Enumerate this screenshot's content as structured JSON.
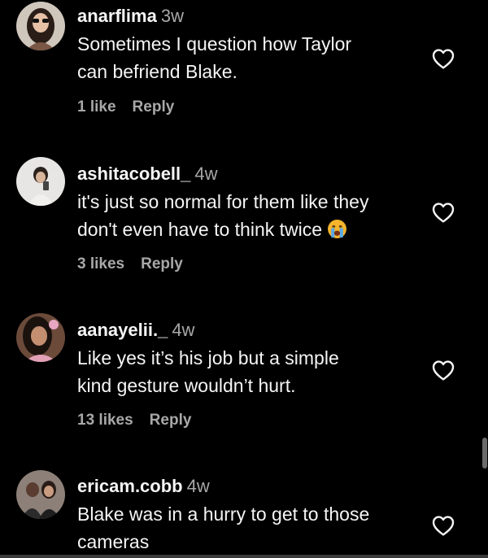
{
  "comments": [
    {
      "username": "anarflima",
      "time": "3w",
      "text_lines": [
        "Sometimes I question how Taylor",
        "can befriend Blake."
      ],
      "likes": "1 like",
      "reply": "Reply",
      "avatar_icon": "profile-photo-woman-glasses",
      "has_emoji": false
    },
    {
      "username": "ashitacobell_",
      "time": "4w",
      "text_lines": [
        "it's just so normal for them like they",
        "don't even have to think twice"
      ],
      "likes": "3 likes",
      "reply": "Reply",
      "avatar_icon": "profile-photo-selfie",
      "has_emoji": true,
      "emoji": "loudly-crying-face-emoji"
    },
    {
      "username": "aanayelii._",
      "time": "4w",
      "text_lines": [
        "Like yes it’s his job but a simple",
        "kind gesture wouldn’t hurt."
      ],
      "likes": "13 likes",
      "reply": "Reply",
      "avatar_icon": "profile-photo-woman",
      "has_emoji": false
    },
    {
      "username": "ericam.cobb",
      "time": "4w",
      "text_lines": [
        "Blake was in a hurry to get to those",
        "cameras"
      ],
      "likes": "",
      "reply": "",
      "avatar_icon": "profile-photo-couple",
      "has_emoji": false
    }
  ],
  "colors": {
    "background": "#000000",
    "primary_text": "#f5f5f5",
    "secondary_text": "#a8a8a8"
  },
  "icons": {
    "like": "heart-outline-icon"
  }
}
